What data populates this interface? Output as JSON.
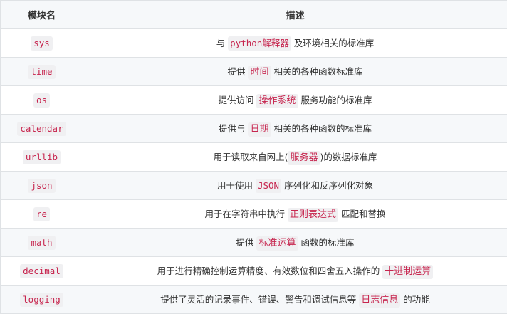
{
  "header": {
    "module": "模块名",
    "description": "描述"
  },
  "rows": [
    {
      "module": "sys",
      "pre": "与 ",
      "hl": "python解释器",
      "post": " 及环境相关的标准库"
    },
    {
      "module": "time",
      "pre": "提供 ",
      "hl": "时间",
      "post": " 相关的各种函数标准库"
    },
    {
      "module": "os",
      "pre": "提供访问 ",
      "hl": "操作系统",
      "post": " 服务功能的标准库"
    },
    {
      "module": "calendar",
      "pre": "提供与 ",
      "hl": "日期",
      "post": " 相关的各种函数的标准库"
    },
    {
      "module": "urllib",
      "pre": "用于读取来自网上(",
      "hl": "服务器",
      "post": ")的数据标准库"
    },
    {
      "module": "json",
      "pre": "用于使用 ",
      "hl": "JSON",
      "post": " 序列化和反序列化对象"
    },
    {
      "module": "re",
      "pre": "用于在字符串中执行 ",
      "hl": "正则表达式",
      "post": " 匹配和替换"
    },
    {
      "module": "math",
      "pre": "提供 ",
      "hl": "标准运算",
      "post": " 函数的标准库"
    },
    {
      "module": "decimal",
      "pre": "用于进行精确控制运算精度、有效数位和四舍五入操作的 ",
      "hl": "十进制运算",
      "post": ""
    },
    {
      "module": "logging",
      "pre": "提供了灵活的记录事件、错误、警告和调试信息等 ",
      "hl": "日志信息",
      "post": " 的功能"
    }
  ]
}
